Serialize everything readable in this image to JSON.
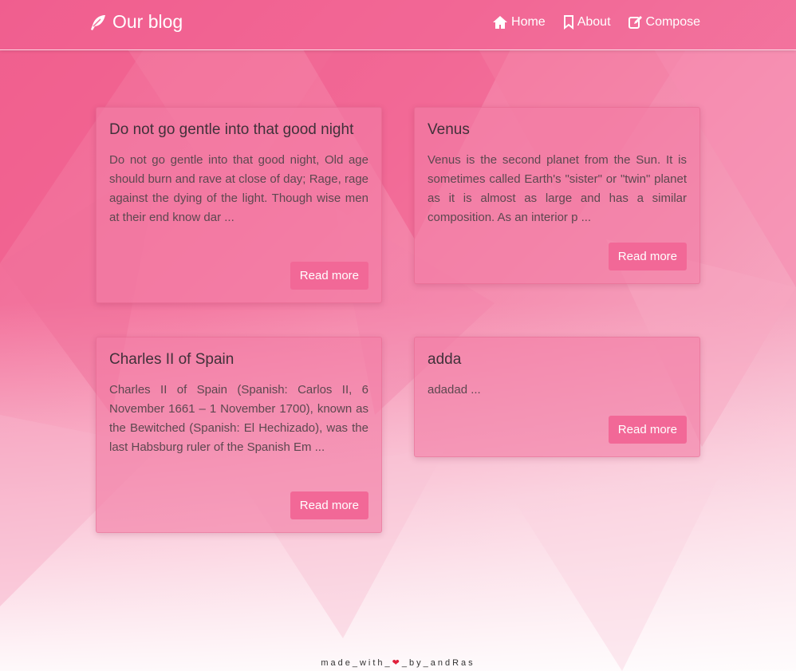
{
  "nav": {
    "brand": "Our blog",
    "brand_icon": "feather-pen-icon",
    "items": [
      {
        "label": "Home",
        "icon": "home-icon"
      },
      {
        "label": "About",
        "icon": "bookmark-icon"
      },
      {
        "label": "Compose",
        "icon": "compose-icon"
      }
    ]
  },
  "posts": [
    {
      "title": "Do not go gentle into that good night",
      "excerpt": "Do not go gentle into that good night, Old age should burn and rave at close of day; Rage, rage against the dying of the light. Though wise men at their end know dar ...",
      "button": "Read more"
    },
    {
      "title": "Venus",
      "excerpt": "Venus is the second planet from the Sun. It is sometimes called Earth's \"sister\" or \"twin\" planet as it is almost as large and has a similar composition. As an interior p ...",
      "button": "Read more"
    },
    {
      "title": "Charles II of Spain",
      "excerpt": "Charles II of Spain (Spanish: Carlos II, 6 November 1661 – 1 November 1700), known as the Bewitched (Spanish: El Hechizado), was the last Habsburg ruler of the Spanish Em ...",
      "button": "Read more"
    },
    {
      "title": "adda",
      "excerpt": "adadad ...",
      "button": "Read more"
    }
  ],
  "footer": {
    "before": "made_with_",
    "heart": "❤",
    "after": "_by_andRas"
  },
  "colors": {
    "accent": "#f26897",
    "background": "#f47aa2"
  }
}
